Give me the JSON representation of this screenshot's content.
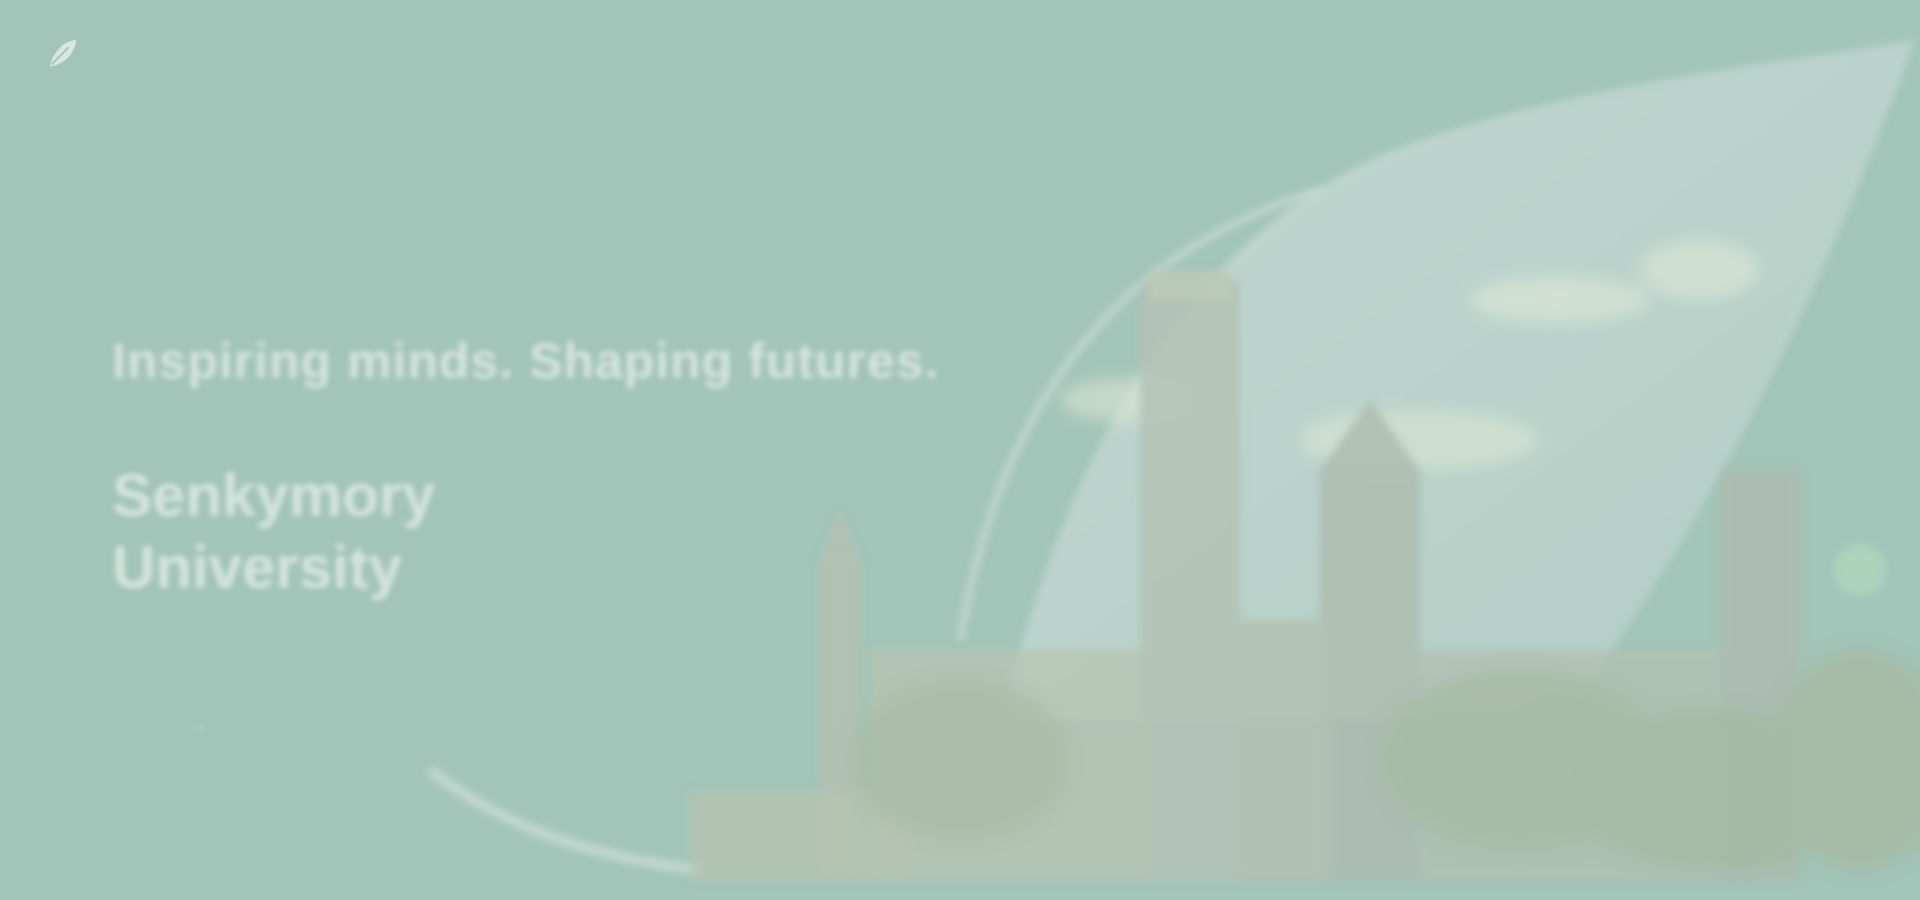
{
  "header": {
    "logo_text": "",
    "nav": [
      "",
      "",
      "",
      "",
      ""
    ],
    "right_links": [
      "",
      ""
    ]
  },
  "hero": {
    "tagline": "Inspiring minds. Shaping futures.",
    "title_line1": "Senkymory",
    "title_line2": "University",
    "links": [
      "",
      "",
      ""
    ]
  },
  "colors": {
    "background": "#a3c4b9",
    "text": "#eef6f2",
    "sky": "#c8dcd6"
  },
  "icons": {
    "logo": "leaf-icon",
    "link_arrow": "arrow-right-icon",
    "badge": "circle-badge-icon"
  }
}
